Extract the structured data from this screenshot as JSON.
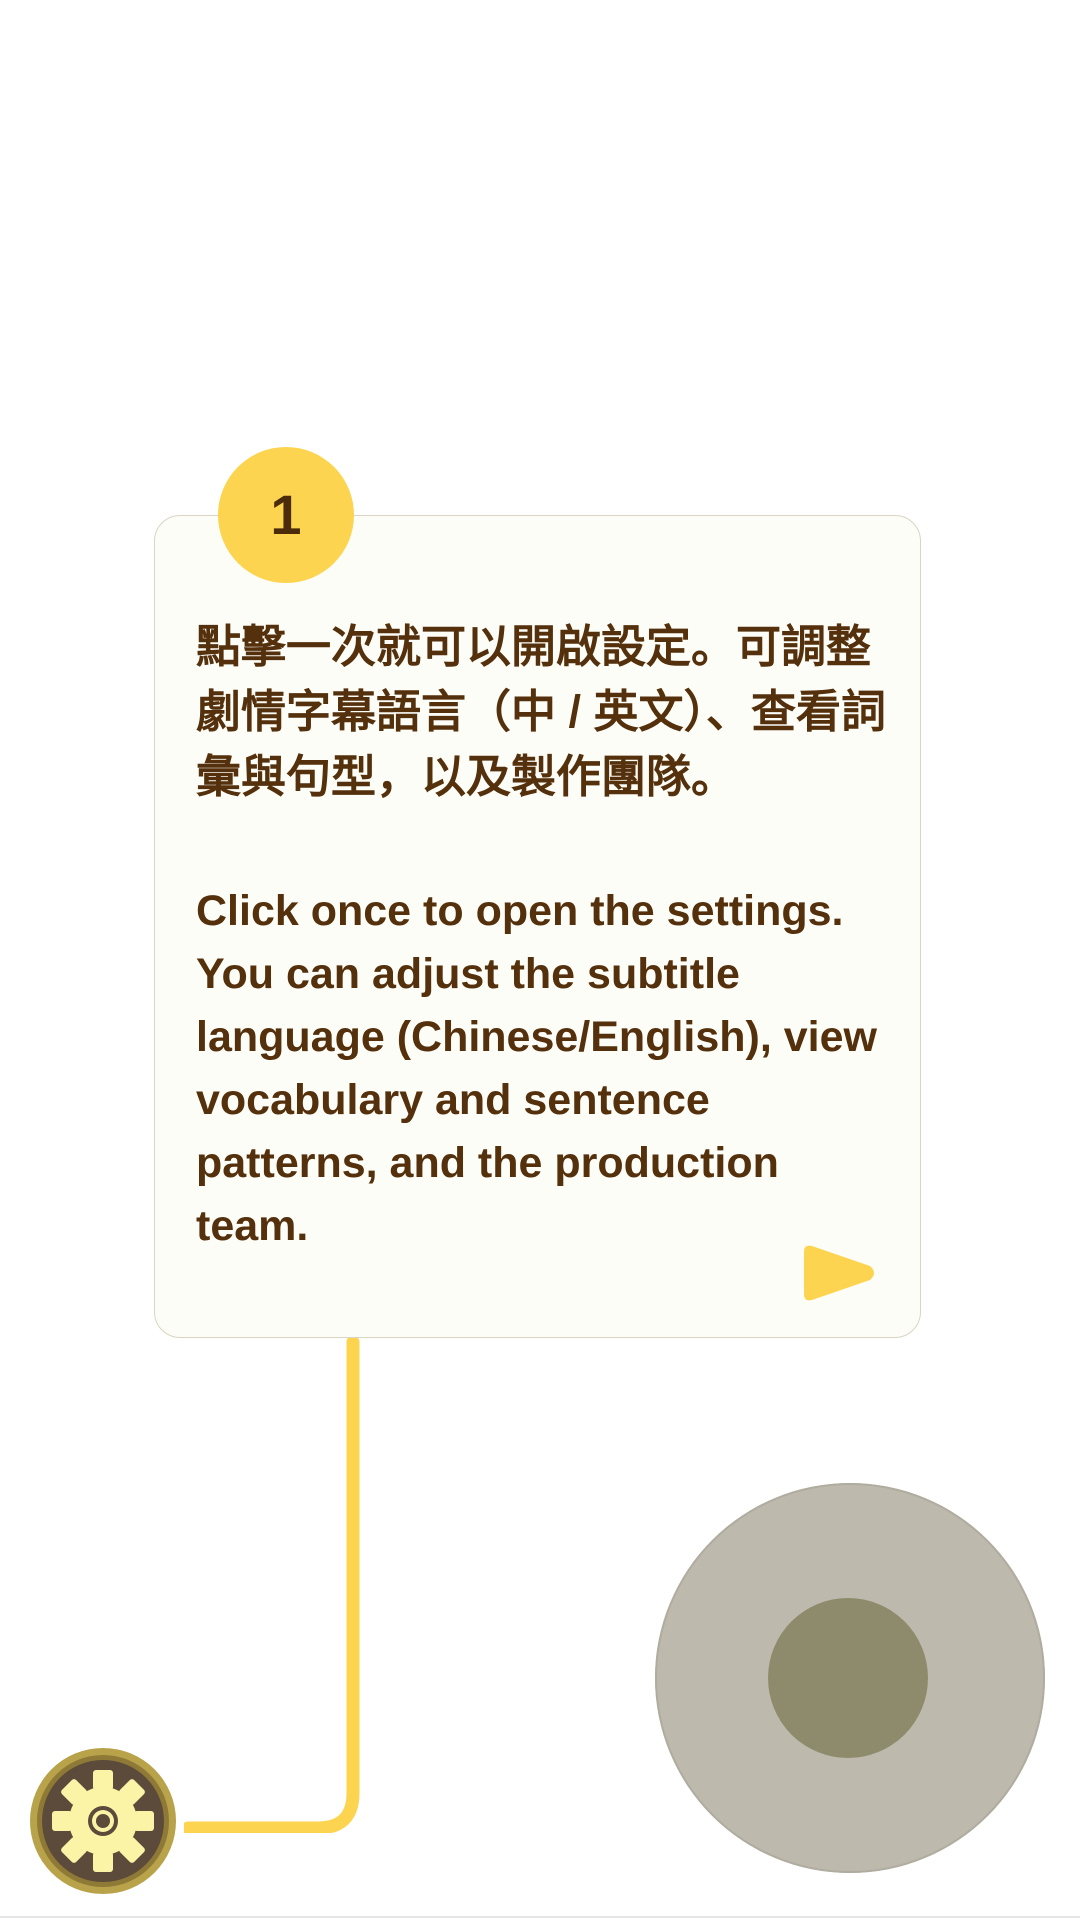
{
  "tutorial": {
    "step_number": "1",
    "text_zh": "點擊一次就可以開啟設定。可調整劇情字幕語言（中 / 英文）、查看詞彙與句型，以及製作團隊。",
    "text_en": "Click once to open the settings. You can adjust the subtitle language (Chinese/English), view vocabulary and sentence patterns, and the production team.",
    "next_icon": "play-triangle-icon"
  },
  "controls": {
    "settings_icon": "gear-icon",
    "joystick": "virtual-joystick"
  },
  "colors": {
    "accent_yellow": "#fcd44f",
    "text_brown": "#54300c",
    "card_bg": "#fdfdf7",
    "gear_ring": "#b8a24a",
    "gear_bg": "#5c4a3a",
    "gear_fill": "#fbf3a6",
    "joystick_base": "#bdb9ad",
    "joystick_knob": "#8e8b6d"
  }
}
